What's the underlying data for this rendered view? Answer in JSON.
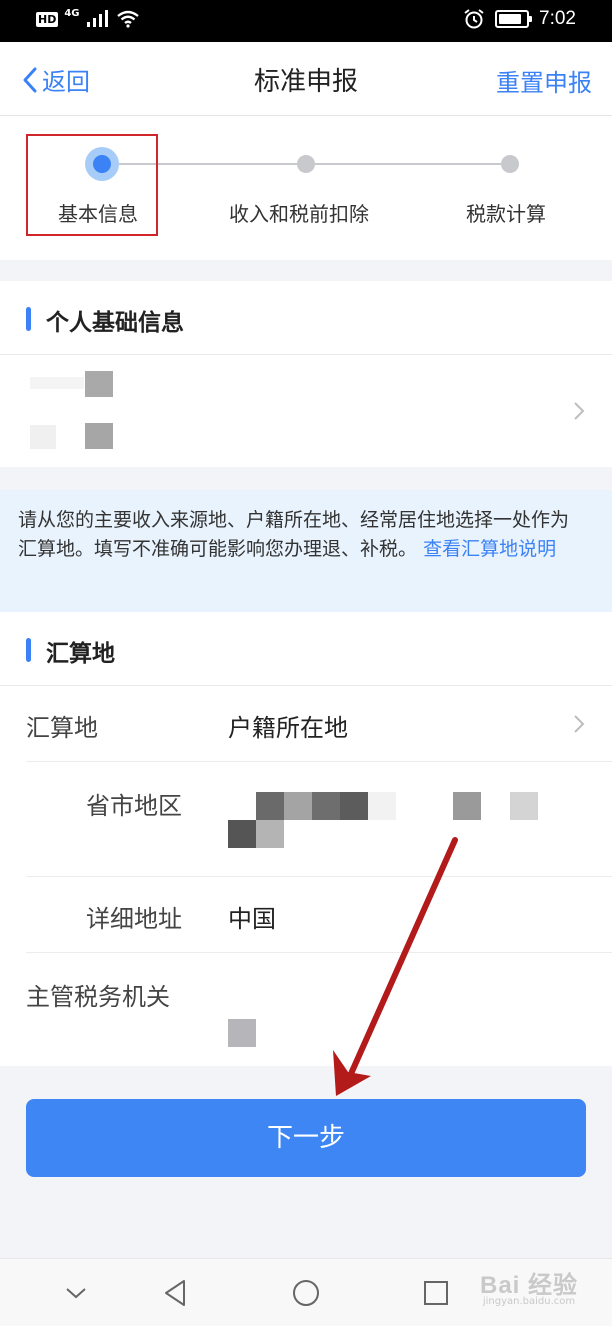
{
  "status_bar": {
    "hd": "HD",
    "network": "4G",
    "time": "7:02",
    "battery_level": 0.85
  },
  "nav": {
    "back_label": "返回",
    "title": "标准申报",
    "reset_label": "重置申报"
  },
  "steps": [
    {
      "label": "基本信息",
      "active": true
    },
    {
      "label": "收入和税前扣除",
      "active": false
    },
    {
      "label": "税款计算",
      "active": false
    }
  ],
  "personal_section": {
    "title": "个人基础信息"
  },
  "notice": {
    "text": "请从您的主要收入来源地、户籍所在地、经常居住地选择一处作为汇算地。填写不准确可能影响您办理退、补税。",
    "link": "查看汇算地说明"
  },
  "settlement_section": {
    "title": "汇算地",
    "rows": {
      "place_label": "汇算地",
      "place_value": "户籍所在地",
      "region_label": "省市地区",
      "address_label": "详细地址",
      "address_value": "中国",
      "tax_office_label": "主管税务机关"
    }
  },
  "next_button": {
    "label": "下一步"
  },
  "watermark": {
    "main": "Bai 经验",
    "sub": "jingyan.baidu.com"
  },
  "colors": {
    "accent": "#3b82f6",
    "highlight": "#d0252b",
    "annotation_arrow": "#b31a1a"
  },
  "icons": {
    "back": "chevron-left-icon",
    "row_arrow": "chevron-right-icon",
    "sys_down": "chevron-down-icon",
    "sys_back": "triangle-back-icon",
    "sys_home": "circle-home-icon",
    "sys_recent": "square-recent-icon"
  }
}
